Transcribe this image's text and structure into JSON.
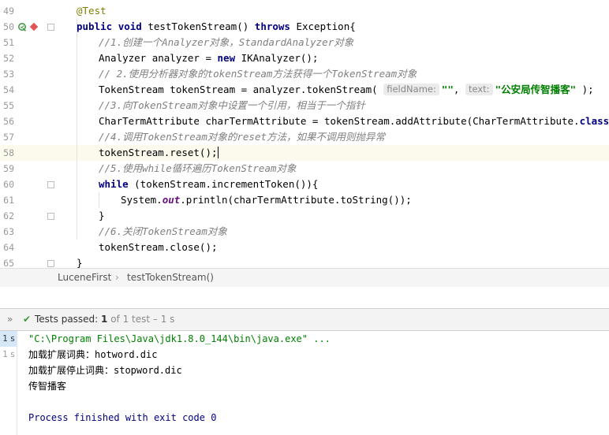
{
  "editor": {
    "lines": [
      {
        "num": "49",
        "indent": 0,
        "tokens": [
          {
            "t": "@Test",
            "c": "ann"
          }
        ]
      },
      {
        "num": "50",
        "indent": 0,
        "tokens": [
          {
            "t": "public ",
            "c": "kw"
          },
          {
            "t": "void ",
            "c": "kw"
          },
          {
            "t": "testTokenStream() "
          },
          {
            "t": "throws ",
            "c": "kw"
          },
          {
            "t": "Exception{"
          }
        ]
      },
      {
        "num": "51",
        "indent": 1,
        "tokens": [
          {
            "t": "//1.创建一个Analyzer对象，StandardAnalyzer对象",
            "c": "cmt"
          }
        ]
      },
      {
        "num": "52",
        "indent": 1,
        "tokens": [
          {
            "t": "Analyzer analyzer = "
          },
          {
            "t": "new ",
            "c": "kw"
          },
          {
            "t": "IKAnalyzer();"
          }
        ]
      },
      {
        "num": "53",
        "indent": 1,
        "tokens": [
          {
            "t": "// 2.使用分析器对象的tokenStream方法获得一个TokenStream对象",
            "c": "cmt"
          }
        ]
      },
      {
        "num": "54",
        "indent": 1,
        "tokens": [
          {
            "t": "TokenStream tokenStream = analyzer.tokenStream( "
          },
          {
            "t": "fieldName:",
            "c": "hint"
          },
          {
            "t": "\"\"",
            "c": "str"
          },
          {
            "t": ", "
          },
          {
            "t": "text:",
            "c": "hint"
          },
          {
            "t": "\"公安局传智播客\"",
            "c": "str"
          },
          {
            "t": " );"
          }
        ]
      },
      {
        "num": "55",
        "indent": 1,
        "tokens": [
          {
            "t": "//3.向TokenStream对象中设置一个引用，相当于一个指针",
            "c": "cmt"
          }
        ]
      },
      {
        "num": "56",
        "indent": 1,
        "tokens": [
          {
            "t": "CharTermAttribute charTermAttribute = tokenStream.addAttribute(CharTermAttribute."
          },
          {
            "t": "class",
            "c": "kw"
          },
          {
            "t": ");"
          }
        ]
      },
      {
        "num": "57",
        "indent": 1,
        "tokens": [
          {
            "t": "//4.调用TokenStream对象的reset方法，如果不调用则抛异常",
            "c": "cmt"
          }
        ]
      },
      {
        "num": "58",
        "indent": 1,
        "current": true,
        "tokens": [
          {
            "t": "tokenStream.reset();"
          },
          {
            "t": "",
            "c": "caret"
          }
        ]
      },
      {
        "num": "59",
        "indent": 1,
        "tokens": [
          {
            "t": "//5.使用while循环遍历TokenStream对象",
            "c": "cmt"
          }
        ]
      },
      {
        "num": "60",
        "indent": 1,
        "tokens": [
          {
            "t": "while ",
            "c": "kw"
          },
          {
            "t": "(tokenStream.incrementToken()){"
          }
        ]
      },
      {
        "num": "61",
        "indent": 2,
        "tokens": [
          {
            "t": "System."
          },
          {
            "t": "out",
            "c": "static"
          },
          {
            "t": ".println(charTermAttribute.toString());"
          }
        ]
      },
      {
        "num": "62",
        "indent": 1,
        "tokens": [
          {
            "t": "}"
          }
        ]
      },
      {
        "num": "63",
        "indent": 1,
        "tokens": [
          {
            "t": "//6.关闭TokenStream对象",
            "c": "cmt"
          }
        ]
      },
      {
        "num": "64",
        "indent": 1,
        "tokens": [
          {
            "t": "tokenStream.close();"
          }
        ]
      },
      {
        "num": "65",
        "indent": 0,
        "tokens": [
          {
            "t": "}"
          }
        ]
      }
    ]
  },
  "breadcrumb": {
    "class_name": "LuceneFirst",
    "separator": "›",
    "method_name": "testTokenStream()"
  },
  "run_toolbar": {
    "expand_glyph": "»",
    "check_glyph": "✔",
    "label": "Tests passed: ",
    "passed_count": "1",
    "summary": " of 1 test – 1 s"
  },
  "console": {
    "gutter": [
      {
        "label": "1 s",
        "active": true
      },
      {
        "label": "1 s",
        "active": false
      }
    ],
    "lines": [
      {
        "text": "\"C:\\Program Files\\Java\\jdk1.8.0_144\\bin\\java.exe\" ...",
        "kind": "cmd"
      },
      {
        "text": "加载扩展词典：hotword.dic",
        "kind": "out"
      },
      {
        "text": "加载扩展停止词典：stopword.dic",
        "kind": "out"
      },
      {
        "text": "传智播客",
        "kind": "out"
      },
      {
        "text": "",
        "kind": "out"
      },
      {
        "text": "Process finished with exit code 0",
        "kind": "exit"
      }
    ]
  },
  "icon_names": {
    "run_gutter": "run-test-icon",
    "breakpoint": "breakpoint-icon",
    "fold": "fold-marker-icon",
    "tests_passed": "check-icon"
  },
  "colors": {
    "keyword": "#000080",
    "annotation": "#808000",
    "comment": "#808080",
    "string": "#008000",
    "breakpoint": "#e05555",
    "current_line": "#fcfaed",
    "tests_passed": "#3c9a3c"
  }
}
